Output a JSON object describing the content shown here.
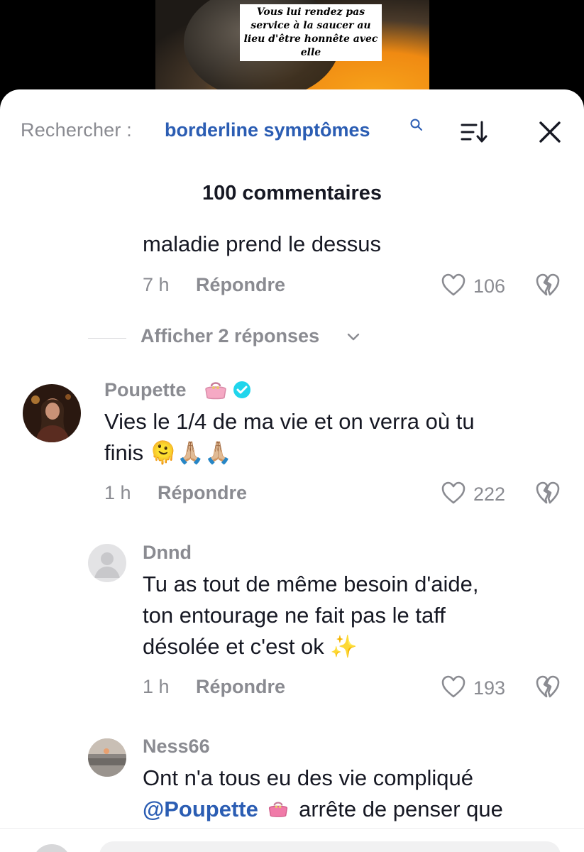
{
  "video": {
    "caption": "Vous lui rendez pas service à la saucer au lieu d'être honnête avec elle"
  },
  "header": {
    "search_prefix": "Rechercher :",
    "search_term": "borderline symptômes",
    "comments_count": "100 commentaires"
  },
  "comments": [
    {
      "text": "maladie prend le dessus",
      "time": "7 h",
      "reply_label": "Répondre",
      "likes": "106"
    },
    {
      "show_replies": "Afficher 2 réponses"
    },
    {
      "username": "Poupette",
      "text_line1": "Vies le 1/4 de ma vie et on verra où tu",
      "text_line2": "finis",
      "emojis": "🫠🙏🏼🙏🏼",
      "time": "1 h",
      "reply_label": "Répondre",
      "likes": "222"
    },
    {
      "username": "Dnnd",
      "text_line1": "Tu as tout de même besoin d'aide,",
      "text_line2": "ton entourage ne fait pas le taff",
      "text_line3": "désolée et c'est ok",
      "emoji": "✨",
      "time": "1 h",
      "reply_label": "Répondre",
      "likes": "193"
    },
    {
      "username": "Ness66",
      "text_line1": "Ont n'a tous eu des vie compliqué",
      "mention": "@Poupette",
      "text_line2_rest": "arrête de penser que"
    }
  ],
  "colors": {
    "accent_blue": "#2b5db3",
    "muted": "#8a8b91",
    "verified": "#20d5ec",
    "purse_pink": "#f5a9c4"
  },
  "icons": [
    "search-icon",
    "sort-icon",
    "close-icon",
    "heart-icon",
    "broken-heart-icon",
    "chevron-down-icon",
    "verified-icon",
    "purse-icon"
  ]
}
